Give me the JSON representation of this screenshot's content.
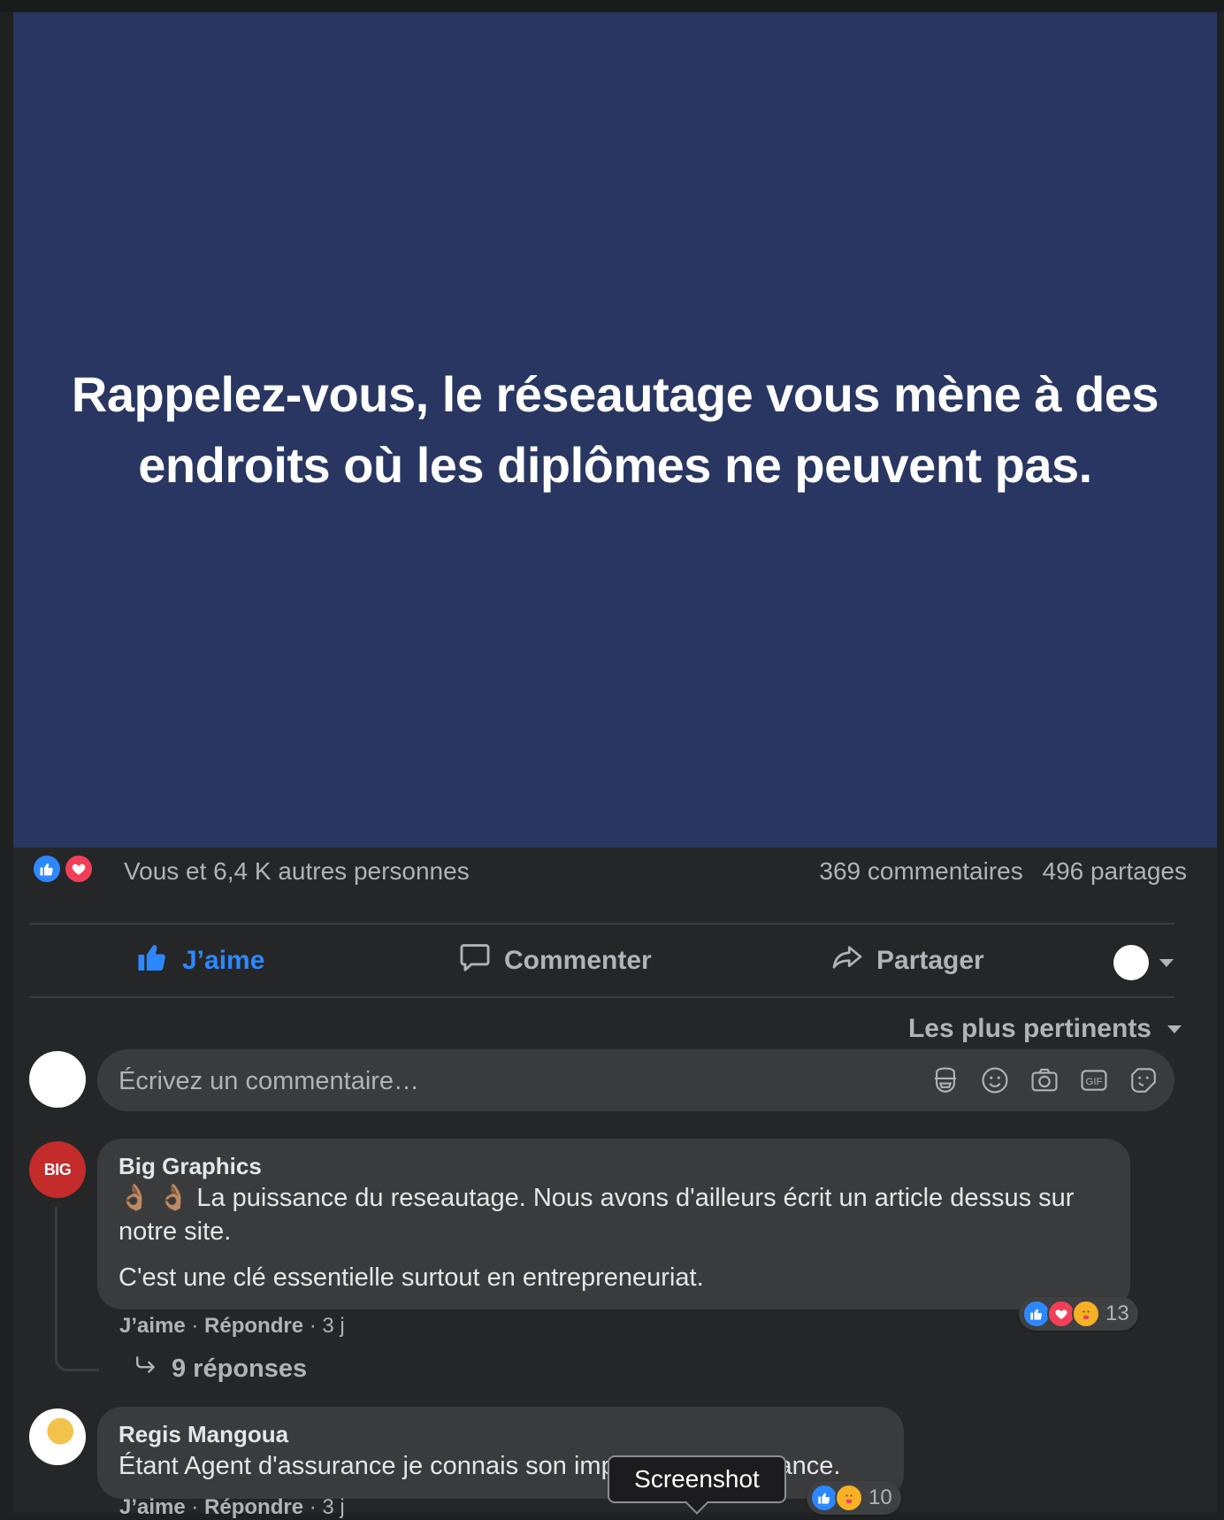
{
  "post": {
    "image_text": "Rappelez-vous, le réseautage vous mène à des endroits où les diplômes ne peuvent pas."
  },
  "stats": {
    "reactions_text": "Vous et 6,4 K autres personnes",
    "comments": "369 commentaires",
    "shares": "496 partages"
  },
  "actions": {
    "like": "J’aime",
    "comment": "Commenter",
    "share": "Partager"
  },
  "sort": {
    "label": "Les plus pertinents"
  },
  "composer": {
    "placeholder": "Écrivez un commentaire…"
  },
  "comments": [
    {
      "author": "Big Graphics",
      "avatar_text": "BIG",
      "body_1": "👌🏽 👌🏽 La puissance du reseautage. Nous avons d'ailleurs écrit un article dessus sur notre site.",
      "body_2": "C'est une clé essentielle surtout en entrepreneuriat.",
      "like": "J’aime",
      "reply": "Répondre",
      "time": "3 j",
      "reaction_count": "13",
      "replies": "9 réponses"
    },
    {
      "author": "Regis Mangoua",
      "body": "Étant Agent d'assurance je connais son importance. Puissance.",
      "like": "J’aime",
      "reply": "Répondre",
      "time": "3 j",
      "reaction_count": "10"
    }
  ],
  "tooltip": {
    "label": "Screenshot"
  },
  "colors": {
    "image_background": "#283661",
    "like_blue": "#2d88ff",
    "love_red": "#f33e58",
    "card_background": "#252628"
  }
}
